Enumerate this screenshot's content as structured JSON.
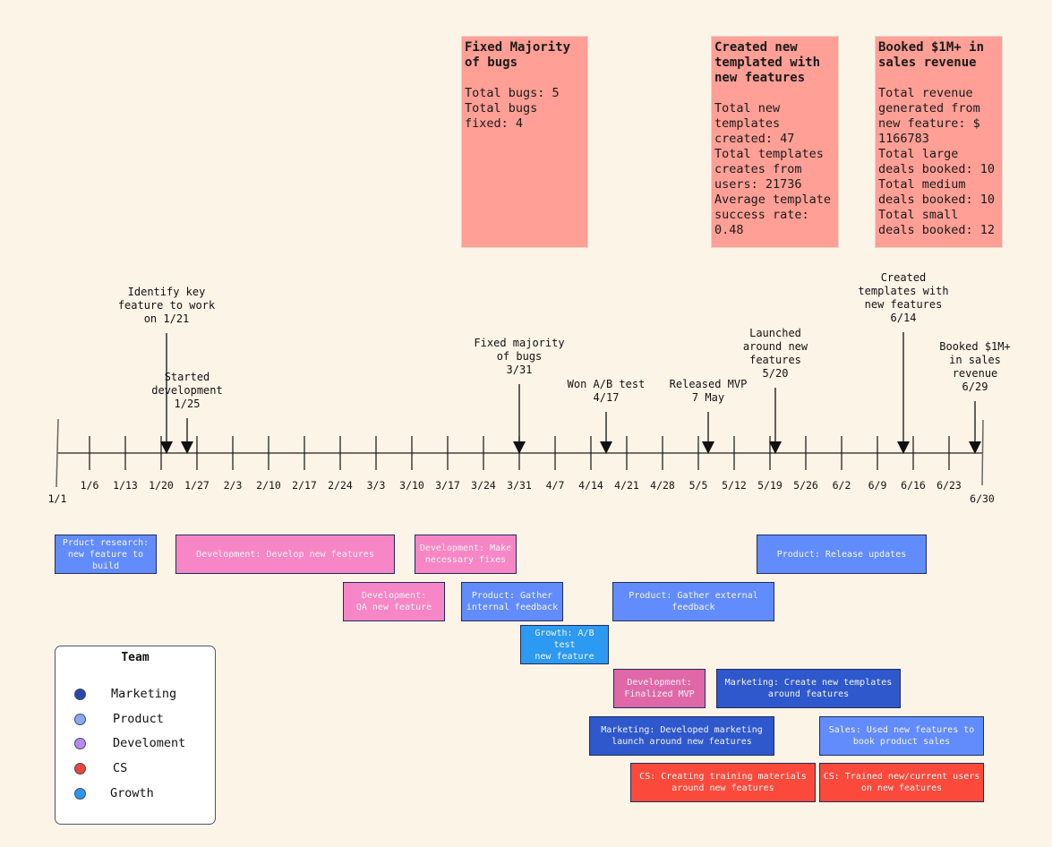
{
  "summary_cards": [
    {
      "title": "Fixed Majority\nof bugs",
      "body": "Total bugs: 5\nTotal bugs\nfixed: 4"
    },
    {
      "title": "Created new\ntemplated with\nnew features",
      "body": "Total new\ntemplates\ncreated: 47\nTotal templates\ncreates from\nusers: 21736\nAverage template\nsuccess rate:\n0.48"
    },
    {
      "title": "Booked $1M+ in\nsales revenue",
      "body": "Total revenue\ngenerated from\nnew feature: $\n1166783\nTotal large\ndeals booked: 10\nTotal medium\ndeals booked: 10\nTotal small\ndeals booked: 12"
    }
  ],
  "timeline": {
    "start_label": "1/1",
    "end_label": "6/30",
    "ticks": [
      "1/6",
      "1/13",
      "1/20",
      "1/27",
      "2/3",
      "2/10",
      "2/17",
      "2/24",
      "3/3",
      "3/10",
      "3/17",
      "3/24",
      "3/31",
      "4/7",
      "4/14",
      "4/21",
      "4/28",
      "5/5",
      "5/12",
      "5/19",
      "5/26",
      "6/2",
      "6/9",
      "6/16",
      "6/23"
    ]
  },
  "milestones": [
    {
      "label": "Identify key\nfeature to work\non 1/21",
      "day": 20
    },
    {
      "label": "Started\ndevelopment\n1/25",
      "day": 24
    },
    {
      "label": "Fixed majority\nof bugs\n3/31",
      "day": 89
    },
    {
      "label": "Won A/B test\n4/17",
      "day": 106
    },
    {
      "label": "Released MVP\n7 May",
      "day": 126
    },
    {
      "label": "Launched\naround new\nfeatures\n5/20",
      "day": 139
    },
    {
      "label": "Created\ntemplates with\nnew features\n6/14",
      "day": 164
    },
    {
      "label": "Booked $1M+\nin sales\nrevenue\n6/29",
      "day": 178
    }
  ],
  "tasks": [
    {
      "team": "product",
      "label": "Prduct research:\nnew feature to\nbuild"
    },
    {
      "team": "development",
      "label": "Development: Develop new features"
    },
    {
      "team": "development",
      "label": "Development: Make\nnecessary fixes"
    },
    {
      "team": "product",
      "label": "Product: Release updates"
    },
    {
      "team": "development",
      "label": "Development:\nQA new feature"
    },
    {
      "team": "product",
      "label": "Product: Gather\ninternal feedback"
    },
    {
      "team": "product",
      "label": "Product: Gather external\nfeedback"
    },
    {
      "team": "growth",
      "label": "Growth: A/B\ntest\nnew feature"
    },
    {
      "team": "development",
      "label": "Development:\nFinalized MVP"
    },
    {
      "team": "marketing",
      "label": "Marketing: Create new templates\naround features"
    },
    {
      "team": "marketing",
      "label": "Marketing: Developed marketing\nlaunch around new features"
    },
    {
      "team": "product",
      "label": "Sales: Used new features to\nbook product sales"
    },
    {
      "team": "cs",
      "label": "CS: Creating training materials\naround new features"
    },
    {
      "team": "cs",
      "label": "CS: Trained new/current users\non new features"
    }
  ],
  "legend": {
    "title": "Team",
    "items": [
      {
        "label": "Marketing",
        "color": "#2a47a8"
      },
      {
        "label": "Product",
        "color": "#86aaf0"
      },
      {
        "label": "Develoment",
        "color": "#bb88f0"
      },
      {
        "label": "CS",
        "color": "#f04438"
      },
      {
        "label": "Growth",
        "color": "#2a98f0"
      }
    ]
  },
  "colors": {
    "card": "#ff9f96",
    "product": "#628cfc",
    "development": "#f786c6",
    "development_dark": "#e068a8",
    "growth": "#2b9af0",
    "marketing": "#2f58cc",
    "cs": "#fb4a3c"
  }
}
